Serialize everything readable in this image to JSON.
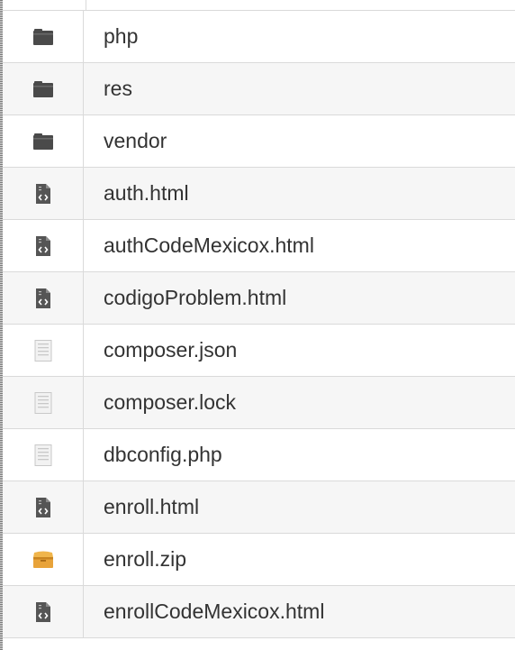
{
  "colors": {
    "folder": "#4a4a4a",
    "code_file": "#555555",
    "text_file": "#c8c8c8",
    "archive": "#e8a33a",
    "row_alt": "#f6f6f6",
    "text": "#333333"
  },
  "files": [
    {
      "name": "php",
      "icon": "folder-icon"
    },
    {
      "name": "res",
      "icon": "folder-icon"
    },
    {
      "name": "vendor",
      "icon": "folder-icon"
    },
    {
      "name": "auth.html",
      "icon": "code-file-icon"
    },
    {
      "name": "authCodeMexicox.html",
      "icon": "code-file-icon"
    },
    {
      "name": "codigoProblem.html",
      "icon": "code-file-icon"
    },
    {
      "name": "composer.json",
      "icon": "text-file-icon"
    },
    {
      "name": "composer.lock",
      "icon": "text-file-icon"
    },
    {
      "name": "dbconfig.php",
      "icon": "text-file-icon"
    },
    {
      "name": "enroll.html",
      "icon": "code-file-icon"
    },
    {
      "name": "enroll.zip",
      "icon": "archive-icon"
    },
    {
      "name": "enrollCodeMexicox.html",
      "icon": "code-file-icon"
    }
  ]
}
